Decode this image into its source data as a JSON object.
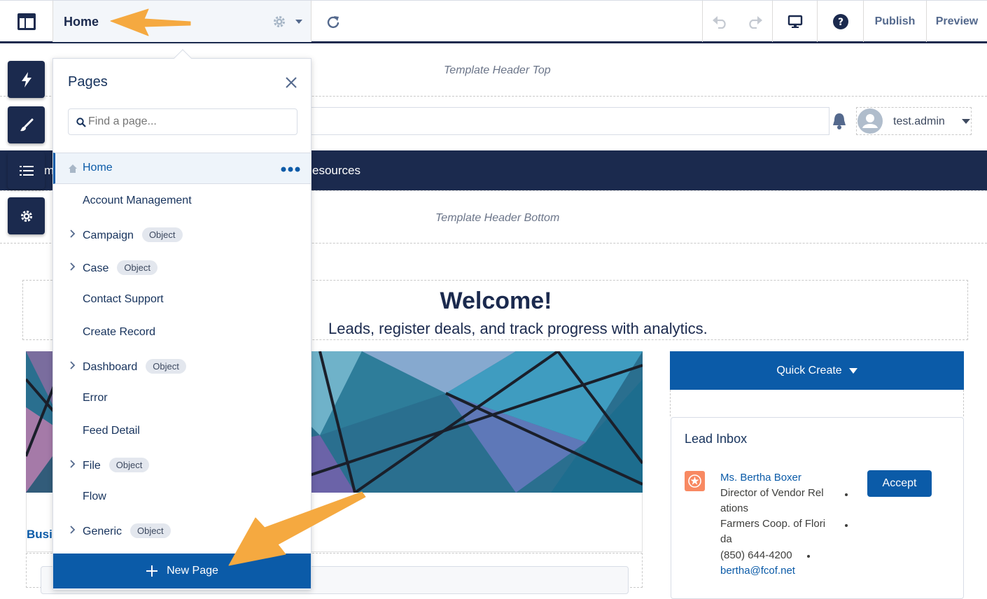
{
  "topbar": {
    "current_page": "Home",
    "publish_label": "Publish",
    "preview_label": "Preview"
  },
  "pages_panel": {
    "title": "Pages",
    "search_placeholder": "Find a page...",
    "items": [
      {
        "label": "Home",
        "selected": true,
        "expandable": false,
        "badge": ""
      },
      {
        "label": "Account Management",
        "expandable": false,
        "badge": ""
      },
      {
        "label": "Campaign",
        "expandable": true,
        "badge": "Object"
      },
      {
        "label": "Case",
        "expandable": true,
        "badge": "Object"
      },
      {
        "label": "Contact Support",
        "expandable": false,
        "badge": ""
      },
      {
        "label": "Create Record",
        "expandable": false,
        "badge": ""
      },
      {
        "label": "Dashboard",
        "expandable": true,
        "badge": "Object"
      },
      {
        "label": "Error",
        "expandable": false,
        "badge": ""
      },
      {
        "label": "Feed Detail",
        "expandable": false,
        "badge": ""
      },
      {
        "label": "File",
        "expandable": true,
        "badge": "Object"
      },
      {
        "label": "Flow",
        "expandable": false,
        "badge": ""
      },
      {
        "label": "Generic",
        "expandable": true,
        "badge": "Object"
      }
    ],
    "new_page_label": "New Page"
  },
  "canvas": {
    "header_top_label": "Template Header Top",
    "header_bottom_label": "Template Header Bottom",
    "username": "test.admin",
    "nav_items": [
      "m",
      "esources"
    ],
    "welcome_title": "Welcome!",
    "welcome_subtitle": "Leads, register deals, and track progress with analytics.",
    "business_tab_fragment": "Busi",
    "quick_create_label": "Quick Create",
    "lead_inbox": {
      "title": "Lead Inbox",
      "lead_name": "Ms. Bertha Boxer",
      "title_line1": "Director of Vendor Rel",
      "title_line2": "ations",
      "company_line1": "Farmers Coop. of Flori",
      "company_line2": "da",
      "phone": "(850) 644-4200",
      "email": "bertha@fcof.net",
      "accept_label": "Accept"
    }
  },
  "colors": {
    "navy": "#1b2a4e",
    "brand_blue": "#0b5ba8",
    "annotation_arrow": "#f5a940",
    "lead_icon": "#f88962"
  }
}
